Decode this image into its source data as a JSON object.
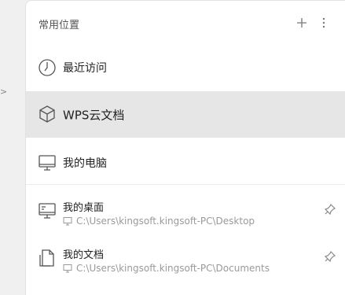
{
  "panel": {
    "title": "常用位置",
    "add_icon": "plus-icon",
    "more_icon": "more-vertical-icon"
  },
  "items": [
    {
      "label": "最近访问",
      "icon": "clock-icon"
    },
    {
      "label": "WPS云文档",
      "icon": "cube-icon",
      "selected": true
    },
    {
      "label": "我的电脑",
      "icon": "monitor-icon"
    },
    {
      "label": "我的桌面",
      "path": "C:\\Users\\kingsoft.kingsoft-PC\\Desktop",
      "icon": "desktop-icon",
      "pin_icon": "pin-icon"
    },
    {
      "label": "我的文档",
      "path": "C:\\Users\\kingsoft.kingsoft-PC\\Documents",
      "icon": "documents-icon",
      "pin_icon": "pin-icon"
    }
  ],
  "colors": {
    "selected_bg": "#e6e6e6",
    "path_text": "#9a9a9a"
  }
}
